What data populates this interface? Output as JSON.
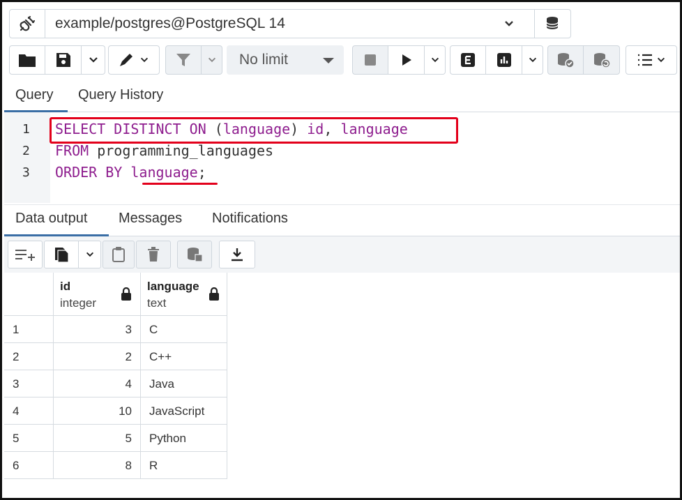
{
  "connection": {
    "label": "example/postgres@PostgreSQL 14"
  },
  "toolbar": {
    "limit_label": "No limit",
    "icons": [
      "folder-icon",
      "save-icon",
      "chevron-down-icon",
      "edit-icon",
      "chevron-down-icon",
      "filter-icon",
      "chevron-down-icon",
      "stop-icon",
      "play-icon",
      "chevron-down-icon",
      "explain-icon",
      "explain-analyze-icon",
      "chevron-down-icon",
      "commit-icon",
      "rollback-icon",
      "macros-icon"
    ]
  },
  "query_tabs": {
    "query": "Query",
    "history": "Query History"
  },
  "editor": {
    "lines": [
      {
        "num": "1",
        "parts": [
          {
            "t": "SELECT DISTINCT ON",
            "c": "kw"
          },
          {
            "t": " ",
            "c": ""
          },
          {
            "t": "(",
            "c": "paren"
          },
          {
            "t": "language",
            "c": "kw"
          },
          {
            "t": ")",
            "c": "paren"
          },
          {
            "t": " ",
            "c": ""
          },
          {
            "t": "id",
            "c": "kw"
          },
          {
            "t": ", ",
            "c": ""
          },
          {
            "t": "language",
            "c": "kw"
          }
        ]
      },
      {
        "num": "2",
        "parts": [
          {
            "t": "FROM",
            "c": "kw"
          },
          {
            "t": " programming_languages",
            "c": ""
          }
        ]
      },
      {
        "num": "3",
        "parts": [
          {
            "t": "ORDER BY",
            "c": "kw"
          },
          {
            "t": " ",
            "c": ""
          },
          {
            "t": "language",
            "c": "kw"
          },
          {
            "t": ";",
            "c": ""
          }
        ]
      }
    ]
  },
  "output_tabs": {
    "data": "Data output",
    "messages": "Messages",
    "notifications": "Notifications"
  },
  "grid": {
    "columns": [
      {
        "name": "id",
        "type": "integer"
      },
      {
        "name": "language",
        "type": "text"
      }
    ],
    "rows": [
      {
        "n": "1",
        "id": "3",
        "language": "C"
      },
      {
        "n": "2",
        "id": "2",
        "language": "C++"
      },
      {
        "n": "3",
        "id": "4",
        "language": "Java"
      },
      {
        "n": "4",
        "id": "10",
        "language": "JavaScript"
      },
      {
        "n": "5",
        "id": "5",
        "language": "Python"
      },
      {
        "n": "6",
        "id": "8",
        "language": "R"
      }
    ]
  },
  "colors": {
    "keyword": "#8e1d8e",
    "highlight": "#e3001b",
    "active_tab": "#3a6ea5"
  }
}
